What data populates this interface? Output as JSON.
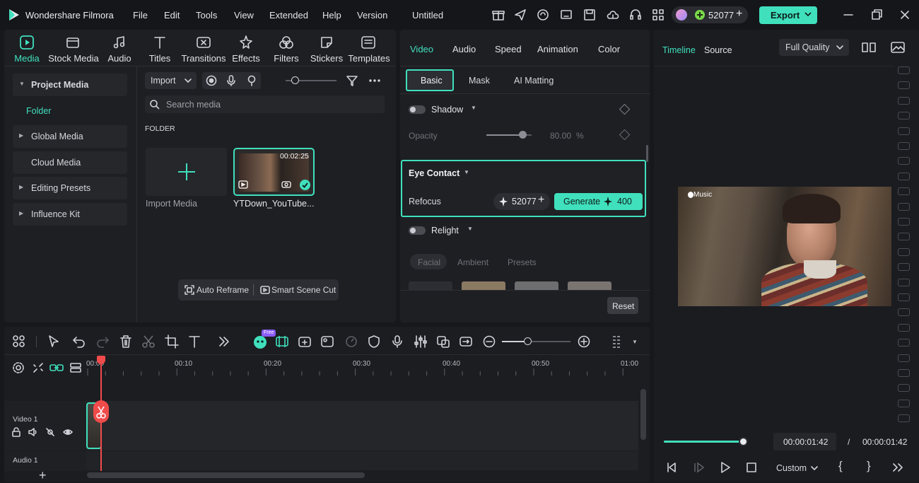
{
  "app": {
    "name": "Wondershare Filmora",
    "project": "Untitled"
  },
  "menu": [
    "File",
    "Edit",
    "Tools",
    "View",
    "Extended",
    "Help",
    "Version"
  ],
  "credits": "52077",
  "export_label": "Export",
  "media_tabs": [
    "Media",
    "Stock Media",
    "Audio",
    "Titles",
    "Transitions",
    "Effects",
    "Filters",
    "Stickers",
    "Templates"
  ],
  "sidebar": {
    "project_media": "Project Media",
    "folder": "Folder",
    "global_media": "Global Media",
    "cloud_media": "Cloud Media",
    "editing_presets": "Editing Presets",
    "influence_kit": "Influence Kit"
  },
  "media": {
    "import_label": "Import",
    "search_placeholder": "Search media",
    "folder_heading": "FOLDER",
    "import_tile_label": "Import Media",
    "clip_name": "YTDown_YouTube...",
    "clip_duration": "00:02:25",
    "auto_reframe": "Auto Reframe",
    "smart_scene_cut": "Smart Scene Cut"
  },
  "properties": {
    "tabs": [
      "Video",
      "Audio",
      "Speed",
      "Animation",
      "Color"
    ],
    "subtabs": [
      "Basic",
      "Mask",
      "AI Matting"
    ],
    "shadow": "Shadow",
    "opacity_label": "Opacity",
    "opacity_value": "80.00",
    "opacity_unit": "%",
    "opacity_level": 0.8,
    "eye_contact": "Eye Contact",
    "refocus": "Refocus",
    "refocus_credits": "52077",
    "generate_label": "Generate",
    "generate_cost": "400",
    "relight": "Relight",
    "relight_tabs": [
      "Facial",
      "Ambient",
      "Presets"
    ],
    "reset_label": "Reset"
  },
  "preview": {
    "tab_timeline": "Timeline",
    "tab_source": "Source",
    "quality": "Full Quality",
    "watermark": "Music",
    "current_time": "00:00:01:42",
    "separator": "/",
    "total_time": "00:00:01:42",
    "zoom_label": "Custom",
    "progress": 1.0
  },
  "timeline": {
    "ai_badge": "Free",
    "ruler": [
      "00:00",
      "00:10",
      "00:20",
      "00:30",
      "00:40",
      "00:50",
      "01:00"
    ],
    "video_track": "Video 1",
    "audio_track": "Audio 1"
  },
  "colors": {
    "accent": "#40e0bd",
    "playhead": "#f04b4b",
    "panel": "#1e1f23",
    "background": "#17181b"
  }
}
